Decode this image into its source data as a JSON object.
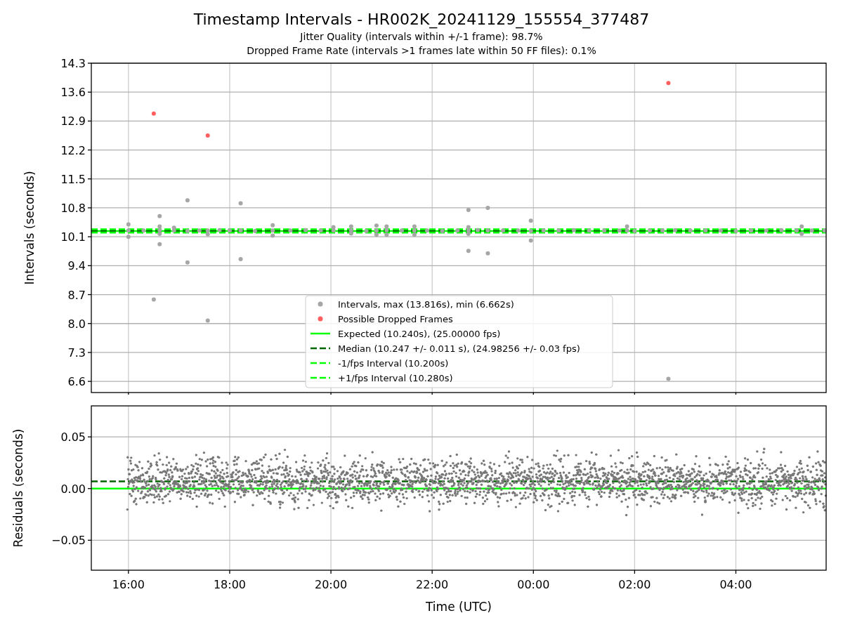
{
  "figure": {
    "title": "Timestamp Intervals - HR002K_20241129_155554_377487",
    "subtitles": [
      "Jitter Quality (intervals within +/-1 frame): 98.7%",
      "Dropped Frame Rate (intervals >1 frames late within 50 FF files): 0.1%"
    ]
  },
  "intervals_panel": {
    "chart_data": {
      "type": "scatter",
      "ylabel": "Intervals (seconds)",
      "grid": true,
      "xlim": [
        "2024-11-29T15:16",
        "2024-11-30T05:47"
      ],
      "ylim": [
        6.33,
        14.3
      ],
      "yticks": [
        {
          "value": 6.6,
          "label": "6.6"
        },
        {
          "value": 7.3,
          "label": "7.3"
        },
        {
          "value": 8.0,
          "label": "8.0"
        },
        {
          "value": 8.7,
          "label": "8.7"
        },
        {
          "value": 9.4,
          "label": "9.4"
        },
        {
          "value": 10.1,
          "label": "10.1"
        },
        {
          "value": 10.8,
          "label": "10.8"
        },
        {
          "value": 11.5,
          "label": "11.5"
        },
        {
          "value": 12.2,
          "label": "12.2"
        },
        {
          "value": 12.9,
          "label": "12.9"
        },
        {
          "value": 13.6,
          "label": "13.6"
        },
        {
          "value": 14.3,
          "label": "14.3"
        }
      ],
      "series": [
        {
          "name": "Intervals, max (13.816s), min (6.662s)",
          "color": "#a6a6a6",
          "x": [
            "2024-11-29T16:00",
            "2024-11-29T16:18",
            "2024-11-29T16:37",
            "2024-11-29T16:54",
            "2024-11-29T17:10",
            "2024-11-29T17:24",
            "2024-11-29T17:34",
            "2024-11-29T17:48",
            "2024-11-29T18:00",
            "2024-11-29T18:13",
            "2024-11-29T18:30",
            "2024-11-29T18:51",
            "2024-11-29T19:12",
            "2024-11-29T19:30",
            "2024-11-29T19:48",
            "2024-11-29T20:03",
            "2024-11-29T20:24",
            "2024-11-29T20:42",
            "2024-11-29T20:54",
            "2024-11-29T21:06",
            "2024-11-29T21:24",
            "2024-11-29T21:39",
            "2024-11-29T21:54",
            "2024-11-29T22:12",
            "2024-11-29T22:30",
            "2024-11-29T22:43",
            "2024-11-29T22:54",
            "2024-11-29T23:06",
            "2024-11-29T23:24",
            "2024-11-29T23:42",
            "2024-11-29T23:57",
            "2024-11-30T00:12",
            "2024-11-30T00:30",
            "2024-11-30T00:48",
            "2024-11-30T01:06",
            "2024-11-30T01:24",
            "2024-11-30T01:42",
            "2024-11-30T01:51",
            "2024-11-30T02:00",
            "2024-11-30T02:18",
            "2024-11-30T02:33",
            "2024-11-30T02:48",
            "2024-11-30T03:06",
            "2024-11-30T03:24",
            "2024-11-30T03:42",
            "2024-11-30T04:00",
            "2024-11-30T04:18",
            "2024-11-30T04:36",
            "2024-11-30T04:54",
            "2024-11-30T05:12",
            "2024-11-30T05:30",
            "2024-11-30T05:45",
            "2024-11-29T16:00",
            "2024-11-29T16:00",
            "2024-11-29T16:37",
            "2024-11-29T16:37",
            "2024-11-29T16:37",
            "2024-11-29T16:37",
            "2024-11-29T16:30",
            "2024-11-29T17:34",
            "2024-11-30T02:40",
            "2024-11-29T17:10",
            "2024-11-29T17:10",
            "2024-11-29T18:13",
            "2024-11-29T18:13",
            "2024-11-29T22:43",
            "2024-11-29T22:43",
            "2024-11-29T22:43",
            "2024-11-29T22:43",
            "2024-11-29T23:06",
            "2024-11-29T23:06",
            "2024-11-29T23:57",
            "2024-11-29T23:57",
            "2024-11-29T18:51",
            "2024-11-29T18:51",
            "2024-11-29T20:03",
            "2024-11-29T20:24",
            "2024-11-29T20:24",
            "2024-11-29T20:54",
            "2024-11-29T20:54",
            "2024-11-29T21:06",
            "2024-11-29T21:06",
            "2024-11-29T21:39",
            "2024-11-29T21:39",
            "2024-11-30T01:51",
            "2024-11-30T05:18",
            "2024-11-30T05:18",
            "2024-11-29T16:54",
            "2024-11-29T17:34"
          ],
          "values": [
            10.25,
            10.25,
            10.26,
            10.25,
            10.24,
            10.25,
            10.25,
            10.26,
            10.25,
            10.25,
            10.24,
            10.25,
            10.25,
            10.26,
            10.25,
            10.25,
            10.25,
            10.24,
            10.25,
            10.26,
            10.25,
            10.25,
            10.25,
            10.24,
            10.25,
            10.25,
            10.26,
            10.25,
            10.25,
            10.25,
            10.24,
            10.25,
            10.25,
            10.26,
            10.25,
            10.25,
            10.25,
            10.25,
            10.24,
            10.25,
            10.25,
            10.26,
            10.25,
            10.25,
            10.25,
            10.24,
            10.25,
            10.25,
            10.26,
            10.25,
            10.25,
            10.25,
            10.4,
            10.1,
            10.6,
            9.92,
            10.35,
            10.17,
            8.58,
            8.07,
            6.66,
            10.98,
            9.48,
            10.91,
            9.56,
            10.75,
            9.76,
            10.33,
            10.17,
            10.8,
            9.7,
            10.49,
            10.01,
            10.38,
            10.13,
            10.33,
            10.35,
            10.18,
            10.37,
            10.15,
            10.35,
            10.15,
            10.35,
            10.15,
            10.35,
            10.35,
            10.17,
            10.32,
            10.16
          ]
        },
        {
          "name": "Possible Dropped Frames",
          "color": "#ff5f5f",
          "x": [
            "2024-11-29T16:30",
            "2024-11-29T17:34",
            "2024-11-30T02:40"
          ],
          "values": [
            13.08,
            12.55,
            13.82
          ]
        }
      ],
      "legend": true,
      "ref_lines": [
        {
          "axis": "y",
          "value": 10.24,
          "label": "Expected (10.240s), (25.00000 fps)",
          "color": "#00ff00",
          "line_style": "solid"
        },
        {
          "axis": "y",
          "value": 10.247,
          "label": "Median (10.247 +/- 0.011 s), (24.98256 +/- 0.03 fps)",
          "color": "#006400",
          "line_style": "dashed"
        },
        {
          "axis": "y",
          "value": 10.2,
          "label": "-1/fps Interval (10.200s)",
          "color": "#00ff00",
          "line_style": "dashed"
        },
        {
          "axis": "y",
          "value": 10.28,
          "label": "+1/fps Interval (10.280s)",
          "color": "#00ff00",
          "line_style": "dashed"
        }
      ]
    }
  },
  "residuals_panel": {
    "chart_data": {
      "type": "scatter",
      "xlabel": "Time (UTC)",
      "ylabel": "Residuals (seconds)",
      "grid": true,
      "xlim": [
        "2024-11-29T15:16",
        "2024-11-30T05:47"
      ],
      "ylim": [
        -0.079,
        0.08
      ],
      "xticks": [
        {
          "value": "2024-11-29T16:00",
          "label": "16:00"
        },
        {
          "value": "2024-11-29T18:00",
          "label": "18:00"
        },
        {
          "value": "2024-11-29T20:00",
          "label": "20:00"
        },
        {
          "value": "2024-11-29T22:00",
          "label": "22:00"
        },
        {
          "value": "2024-11-30T00:00",
          "label": "00:00"
        },
        {
          "value": "2024-11-30T02:00",
          "label": "02:00"
        },
        {
          "value": "2024-11-30T04:00",
          "label": "04:00"
        }
      ],
      "yticks": [
        {
          "value": -0.05,
          "label": "−0.05"
        },
        {
          "value": 0,
          "label": "0.00"
        },
        {
          "value": 0.05,
          "label": "0.05"
        }
      ],
      "ref_lines": [
        {
          "axis": "y",
          "value": 0,
          "color": "#00ff00",
          "line_style": "solid"
        },
        {
          "axis": "y",
          "value": 0.007,
          "color": "#006400",
          "line_style": "dashed"
        }
      ]
    }
  }
}
